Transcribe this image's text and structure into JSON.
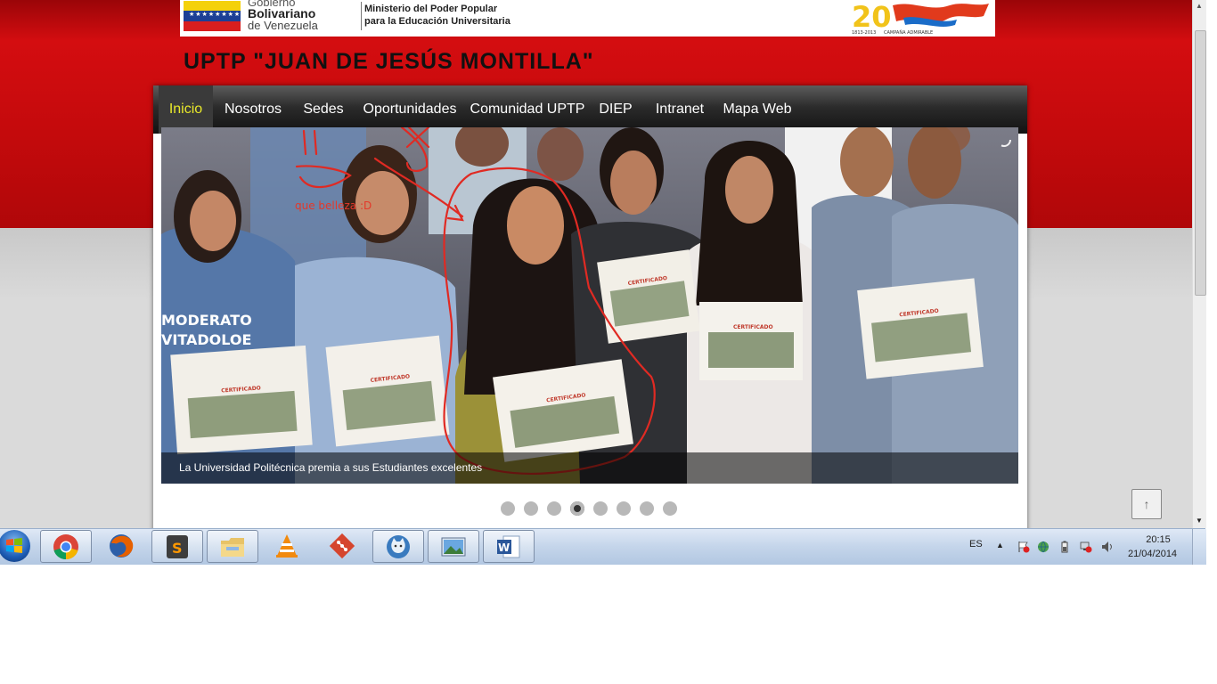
{
  "gov_banner": {
    "line1": "Gobierno",
    "line2": "Bolivariano",
    "line3": "de Venezuela",
    "ministry_line1": "Ministerio del Poder Popular",
    "ministry_line2": "para la Educación Universitaria",
    "anniversary_years": "1813-2013",
    "anniversary_text": "CAMPAÑA ADMIRABLE"
  },
  "site": {
    "title": "UPTP \"JUAN DE JESÚS MONTILLA\""
  },
  "nav": {
    "items": [
      {
        "label": "Inicio",
        "active": true
      },
      {
        "label": "Nosotros",
        "active": false
      },
      {
        "label": "Sedes",
        "active": false
      },
      {
        "label": "Oportunidades",
        "active": false
      },
      {
        "label": "Comunidad UPTP",
        "active": false
      },
      {
        "label": "DIEP",
        "active": false
      },
      {
        "label": "Intranet",
        "active": false
      },
      {
        "label": "Mapa Web",
        "active": false
      }
    ]
  },
  "slider": {
    "caption": "La Universidad Politécnica premia a sus Estudiantes excelentes",
    "certificate_label": "CERTIFICADO",
    "shirt_text_line1": "MODERATO",
    "shirt_text_line2": "VITADOLOE",
    "annotation": "que belleza :D",
    "slide_count": 8,
    "active_slide": 4,
    "loading_icon": "spinner-icon"
  },
  "scroll_top_button": {
    "icon": "arrow-up-icon",
    "glyph": "↑"
  },
  "taskbar": {
    "apps": [
      {
        "name": "chrome",
        "open": true
      },
      {
        "name": "firefox",
        "open": false
      },
      {
        "name": "sublime-text",
        "open": true
      },
      {
        "name": "file-explorer",
        "open": true
      },
      {
        "name": "vlc",
        "open": false
      },
      {
        "name": "git",
        "open": false
      },
      {
        "name": "cat-app",
        "open": true
      },
      {
        "name": "image-viewer",
        "open": true
      },
      {
        "name": "word",
        "open": true
      }
    ],
    "language": "ES",
    "time": "20:15",
    "date": "21/04/2014"
  }
}
